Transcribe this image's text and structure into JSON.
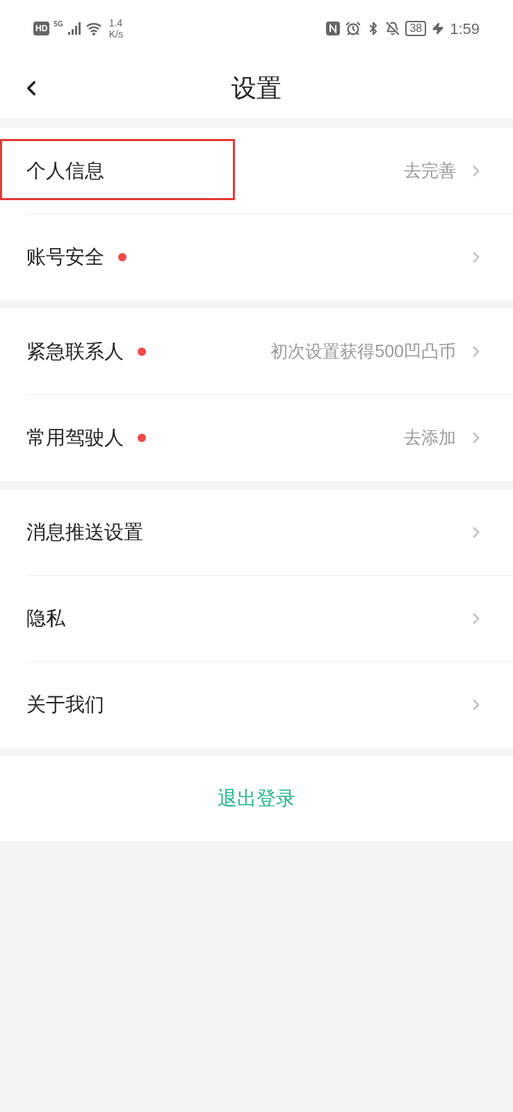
{
  "status_bar": {
    "hd": "HD",
    "network": "5G",
    "speed_value": "1.4",
    "speed_unit": "K/s",
    "battery": "38",
    "time": "1:59"
  },
  "header": {
    "title": "设置"
  },
  "groups": [
    {
      "items": [
        {
          "label": "个人信息",
          "dot": false,
          "value": "去完善",
          "highlighted": true
        },
        {
          "label": "账号安全",
          "dot": true,
          "highlighted": false
        }
      ]
    },
    {
      "items": [
        {
          "label": "紧急联系人",
          "dot": true,
          "value": "初次设置获得500凹凸币",
          "highlighted": false
        },
        {
          "label": "常用驾驶人",
          "dot": true,
          "value": "去添加",
          "highlighted": false
        }
      ]
    },
    {
      "items": [
        {
          "label": "消息推送设置",
          "dot": false,
          "highlighted": false
        },
        {
          "label": "隐私",
          "dot": false,
          "highlighted": false
        },
        {
          "label": "关于我们",
          "dot": false,
          "highlighted": false
        }
      ]
    }
  ],
  "logout": "退出登录"
}
